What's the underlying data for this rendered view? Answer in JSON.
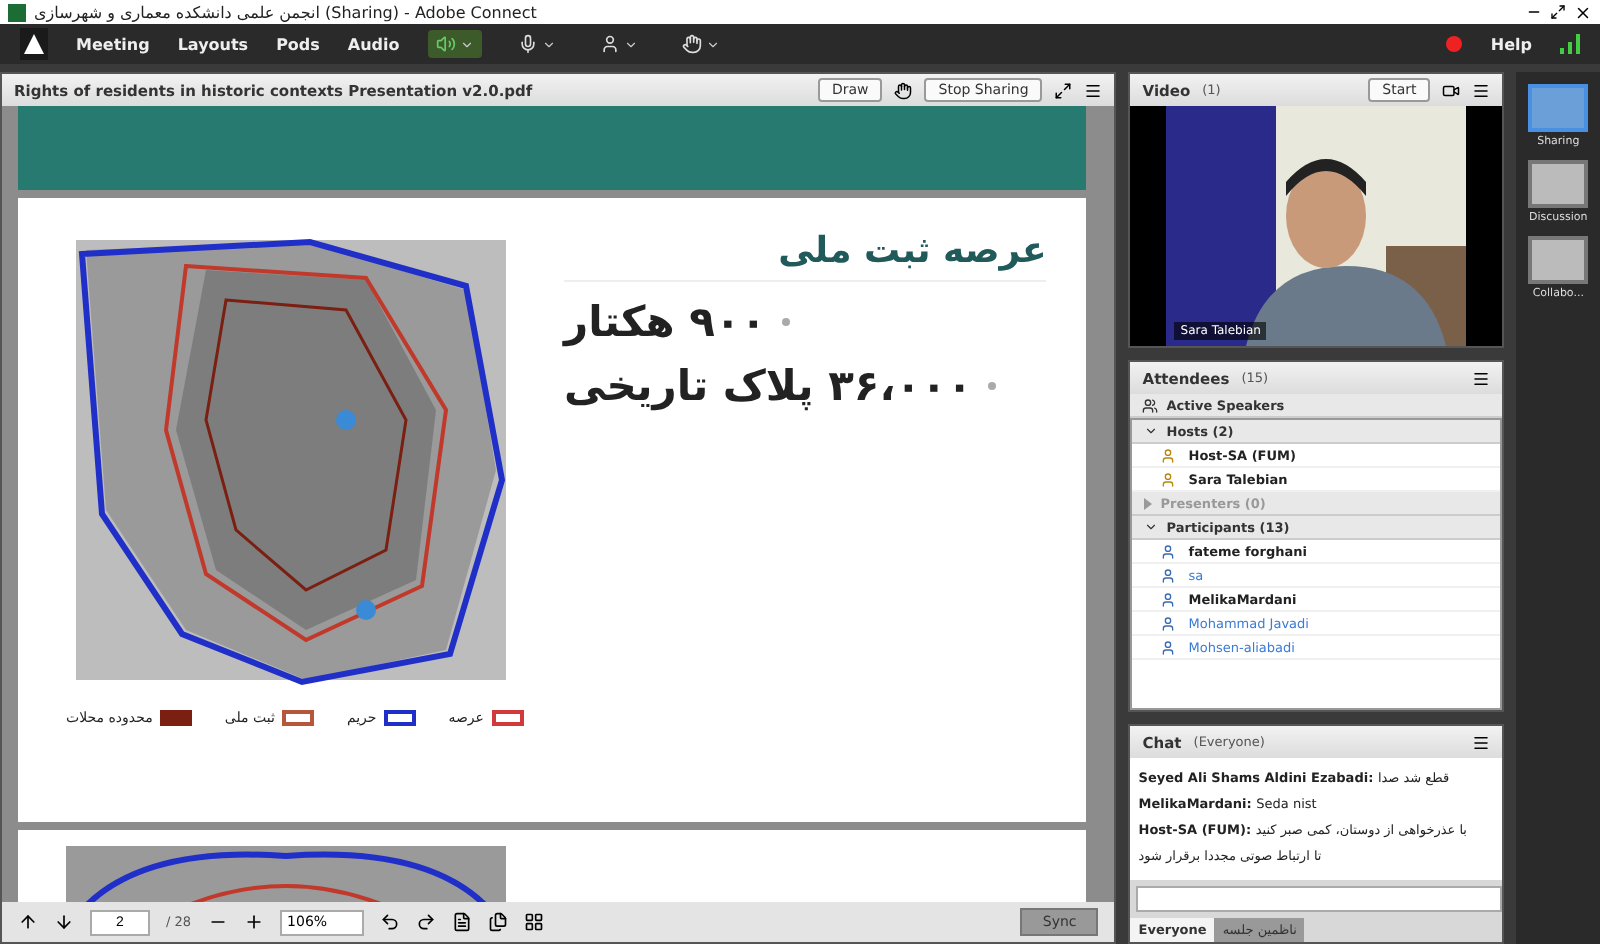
{
  "window": {
    "title": "انجمن علمی دانشکده معماری و شهرسازی (Sharing) - Adobe Connect"
  },
  "menu": [
    "Meeting",
    "Layouts",
    "Pods",
    "Audio"
  ],
  "help": "Help",
  "share_pod": {
    "title": "Rights of residents in historic contexts Presentation v2.0.pdf",
    "buttons": [
      "Draw",
      "Stop Sharing"
    ],
    "slide": {
      "heading": "عرصه ثبت ملی",
      "bullets": [
        "۹۰۰ هکتار",
        "۳۶،۰۰۰ پلاک تاریخی"
      ],
      "legend": [
        {
          "label": "عرصه",
          "color": "#d13a3a",
          "kind": "box"
        },
        {
          "label": "حریم",
          "color": "#1f2fc8",
          "kind": "box"
        },
        {
          "label": "ثبت ملی",
          "color": "#b5573a",
          "kind": "box"
        },
        {
          "label": "محدوده محلات",
          "color": "#7a1f12",
          "kind": "line"
        }
      ]
    },
    "toolbar": {
      "page": "2",
      "total": "/ 28",
      "zoom": "106%",
      "sync": "Sync"
    }
  },
  "video_pod": {
    "title": "Video",
    "count": "(1)",
    "start": "Start",
    "caption": "Sara Talebian"
  },
  "attendees": {
    "title": "Attendees",
    "count": "(15)",
    "active_speakers": "Active Speakers",
    "groups": [
      {
        "label": "Hosts (2)",
        "expanded": true,
        "children": [
          {
            "name": "Host-SA (FUM)",
            "kind": "host",
            "away": false
          },
          {
            "name": "Sara Talebian",
            "kind": "host",
            "away": false
          }
        ]
      },
      {
        "label": "Presenters (0)",
        "expanded": false
      },
      {
        "label": "Participants (13)",
        "expanded": true,
        "children": [
          {
            "name": "fateme forghani",
            "kind": "participant",
            "away": false
          },
          {
            "name": "sa",
            "kind": "participant",
            "away": true
          },
          {
            "name": "MelikaMardani",
            "kind": "participant",
            "away": false
          },
          {
            "name": "Mohammad Javadi",
            "kind": "participant",
            "away": true
          },
          {
            "name": "Mohsen-aliabadi",
            "kind": "participant",
            "away": true
          }
        ]
      }
    ]
  },
  "chat": {
    "title": "Chat",
    "scope": "(Everyone)",
    "messages": [
      {
        "sender": "Seyed Ali Shams Aldini Ezabadi:",
        "text": "قطع شد صدا"
      },
      {
        "sender": "MelikaMardani:",
        "text": "Seda nist"
      },
      {
        "sender": "Host-SA (FUM):",
        "text": "با عذرخواهی از دوستان، کمی صبر کنید"
      },
      {
        "text": "تا ارتباط صوتی مجددا برقرار شود"
      }
    ],
    "tabs": [
      {
        "label": "Everyone",
        "selected": true
      },
      {
        "label": "ناظمین جلسه",
        "selected": false
      }
    ]
  },
  "layouts": [
    {
      "label": "Sharing",
      "selected": true
    },
    {
      "label": "Discussion",
      "selected": false
    },
    {
      "label": "Collabo...",
      "selected": false
    }
  ]
}
